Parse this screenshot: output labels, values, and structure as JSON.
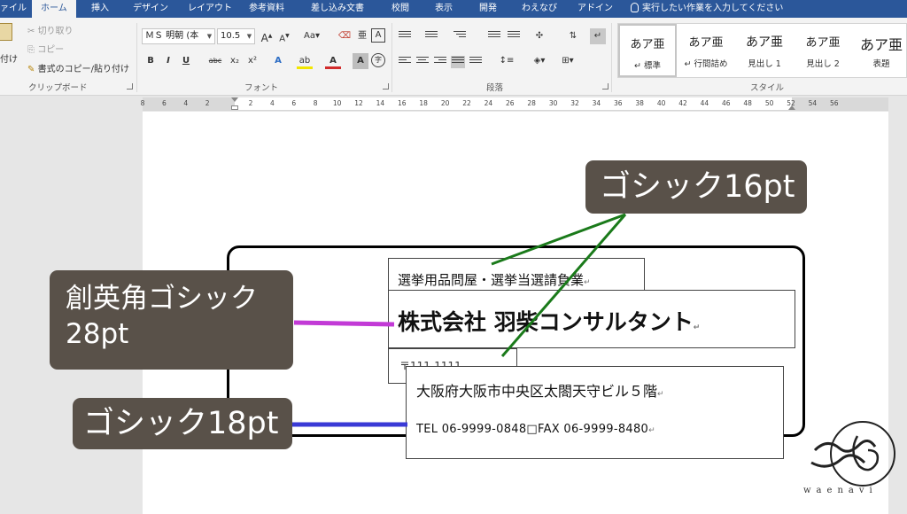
{
  "ribbon_tabs": [
    {
      "label": "ァイル"
    },
    {
      "label": "ホーム",
      "active": true
    },
    {
      "label": "挿入"
    },
    {
      "label": "デザイン"
    },
    {
      "label": "レイアウト"
    },
    {
      "label": "参考資料"
    },
    {
      "label": "差し込み文書"
    },
    {
      "label": "校閲"
    },
    {
      "label": "表示"
    },
    {
      "label": "開発"
    },
    {
      "label": "わえなび"
    },
    {
      "label": "アドイン"
    }
  ],
  "tell_me": {
    "placeholder": "実行したい作業を入力してください",
    "icon": "lightbulb-icon"
  },
  "clipboard": {
    "paste_label": "付け",
    "cut_label": "切り取り",
    "copy_label": "コピー",
    "format_painter_label": "書式のコピー/貼り付け",
    "group_label": "クリップボード"
  },
  "font": {
    "font_name": "ＭＳ 明朝 (本",
    "font_size": "10.5",
    "grow_label": "A",
    "shrink_label": "A",
    "case_label": "Aa",
    "bold_label": "B",
    "italic_label": "I",
    "underline_label": "U",
    "strike_label": "abc",
    "subscript_label": "x₂",
    "superscript_label": "x²",
    "effects_label": "A",
    "highlight_label": "ab",
    "color_label": "A",
    "shade_label": "A",
    "enclose_label": "字",
    "ruby_label": "亜",
    "border_label": "A",
    "group_label": "フォント"
  },
  "paragraph": {
    "group_label": "段落"
  },
  "styles": {
    "items": [
      {
        "preview": "あア亜",
        "name": "標準",
        "selected": true
      },
      {
        "preview": "あア亜",
        "name": "行間詰め"
      },
      {
        "preview": "あア亜",
        "name": "見出し 1"
      },
      {
        "preview": "あア亜",
        "name": "見出し 2"
      },
      {
        "preview": "あア亜",
        "name": "表題"
      }
    ],
    "group_label": "スタイル"
  },
  "ruler_ticks": [
    "8",
    "6",
    "4",
    "2",
    "2",
    "4",
    "6",
    "8",
    "10",
    "12",
    "14",
    "16",
    "18",
    "20",
    "22",
    "24",
    "26",
    "28",
    "30",
    "32",
    "34",
    "36",
    "38",
    "40",
    "42",
    "44",
    "46",
    "48",
    "50",
    "52",
    "54",
    "56"
  ],
  "document": {
    "line1": "選挙用品問屋・選挙当選請負業",
    "company_name": "株式会社 羽柴コンサルタント",
    "postal": "〒111-1111",
    "address": "大阪府大阪市中央区太閤天守ビル５階",
    "tel_fax": "TEL 06-9999-0848□FAX 06-9999-8480",
    "paragraph_mark": "↵"
  },
  "callouts": {
    "gothic16": "ゴシック16pt",
    "soei_line1": "創英角ゴシック",
    "soei_line2": "28pt",
    "gothic18": "ゴシック18pt"
  },
  "colors": {
    "ribbon_blue": "#2b579a",
    "callout_bg": "#595149",
    "leader_green": "#1a7a1a",
    "leader_magenta": "#c23ad6",
    "leader_blue": "#3a3ad6"
  },
  "logo": {
    "text": "waenavi"
  }
}
